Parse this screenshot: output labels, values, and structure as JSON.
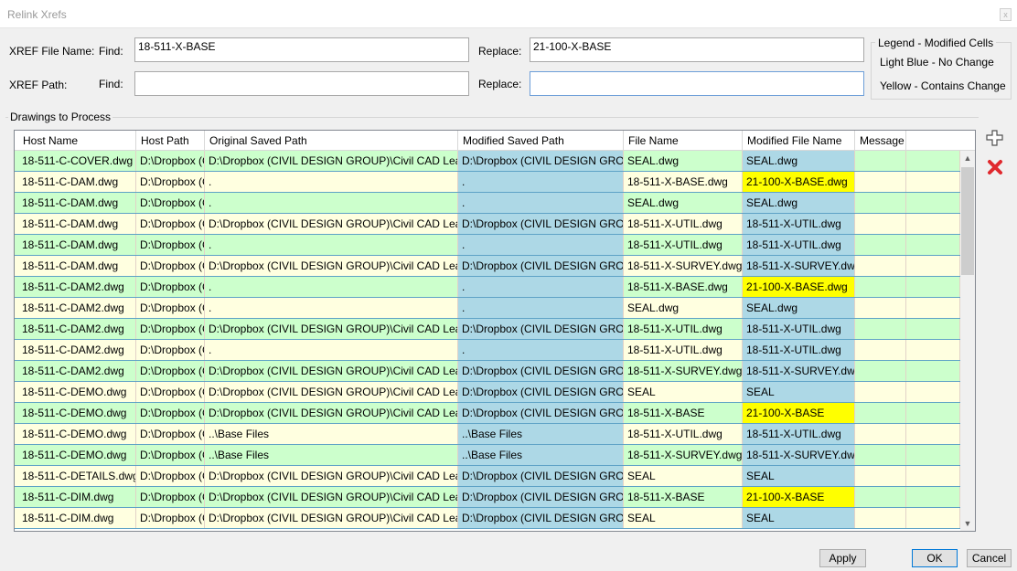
{
  "window": {
    "title": "Relink Xrefs",
    "close_glyph": "x"
  },
  "xref_file_name": {
    "label": "XREF File Name:",
    "find_label": "Find:",
    "find_value": "18-511-X-BASE",
    "replace_label": "Replace:",
    "replace_value": "21-100-X-BASE"
  },
  "xref_path": {
    "label": "XREF Path:",
    "find_label": "Find:",
    "find_value": "",
    "replace_label": "Replace:",
    "replace_value": ""
  },
  "legend": {
    "title": "Legend - Modified Cells",
    "light_blue": "Light Blue - No Change",
    "yellow": "Yellow - Contains Change"
  },
  "drawings": {
    "group_title": "Drawings to Process",
    "columns": [
      "Host Name",
      "Host Path",
      "Original Saved Path",
      "Modified Saved Path",
      "File Name",
      "Modified File Name",
      "Message"
    ],
    "rows": [
      {
        "host": "18-511-C-COVER.dwg",
        "path": "D:\\Dropbox (CIVIL DESIGN GROUP)\\Civil CAD Learn",
        "orig": "D:\\Dropbox (CIVIL DESIGN GROUP)\\Civil CAD Learn",
        "mod": "D:\\Dropbox (CIVIL DESIGN GROUP)\\Civil CAD Learn",
        "file": "SEAL.dwg",
        "mfile": "SEAL.dwg",
        "msg": "",
        "rowc": "g",
        "modc": "blue",
        "mfilec": "blue"
      },
      {
        "host": "18-511-C-DAM.dwg",
        "path": "D:\\Dropbox (CIVIL DESIGN GROUP)\\Civil CAD Learn",
        "orig": ".",
        "mod": ".",
        "file": "18-511-X-BASE.dwg",
        "mfile": "21-100-X-BASE.dwg",
        "msg": "",
        "rowc": "y",
        "modc": "blue",
        "mfilec": "yel"
      },
      {
        "host": "18-511-C-DAM.dwg",
        "path": "D:\\Dropbox (CIVIL DESIGN GROUP)\\Civil CAD Learn",
        "orig": ".",
        "mod": ".",
        "file": "SEAL.dwg",
        "mfile": "SEAL.dwg",
        "msg": "",
        "rowc": "g",
        "modc": "blue",
        "mfilec": "blue"
      },
      {
        "host": "18-511-C-DAM.dwg",
        "path": "D:\\Dropbox (CIVIL DESIGN GROUP)\\Civil CAD Learn",
        "orig": "D:\\Dropbox (CIVIL DESIGN GROUP)\\Civil CAD Learn",
        "mod": "D:\\Dropbox (CIVIL DESIGN GROUP)\\Civil CAD Learn",
        "file": "18-511-X-UTIL.dwg",
        "mfile": "18-511-X-UTIL.dwg",
        "msg": "",
        "rowc": "y",
        "modc": "blue",
        "mfilec": "blue"
      },
      {
        "host": "18-511-C-DAM.dwg",
        "path": "D:\\Dropbox (CIVIL DESIGN GROUP)\\Civil CAD Learn",
        "orig": ".",
        "mod": ".",
        "file": "18-511-X-UTIL.dwg",
        "mfile": "18-511-X-UTIL.dwg",
        "msg": "",
        "rowc": "g",
        "modc": "blue",
        "mfilec": "blue"
      },
      {
        "host": "18-511-C-DAM.dwg",
        "path": "D:\\Dropbox (CIVIL DESIGN GROUP)\\Civil CAD Learn",
        "orig": "D:\\Dropbox (CIVIL DESIGN GROUP)\\Civil CAD Learn",
        "mod": "D:\\Dropbox (CIVIL DESIGN GROUP)\\Civil CAD Learn",
        "file": "18-511-X-SURVEY.dwg",
        "mfile": "18-511-X-SURVEY.dwg",
        "msg": "",
        "rowc": "y",
        "modc": "blue",
        "mfilec": "blue"
      },
      {
        "host": "18-511-C-DAM2.dwg",
        "path": "D:\\Dropbox (CIVIL DESIGN GROUP)\\Civil CAD Learn",
        "orig": ".",
        "mod": ".",
        "file": "18-511-X-BASE.dwg",
        "mfile": "21-100-X-BASE.dwg",
        "msg": "",
        "rowc": "g",
        "modc": "blue",
        "mfilec": "yel"
      },
      {
        "host": "18-511-C-DAM2.dwg",
        "path": "D:\\Dropbox (CIVIL DESIGN GROUP)\\Civil CAD Learn",
        "orig": ".",
        "mod": ".",
        "file": "SEAL.dwg",
        "mfile": "SEAL.dwg",
        "msg": "",
        "rowc": "y",
        "modc": "blue",
        "mfilec": "blue"
      },
      {
        "host": "18-511-C-DAM2.dwg",
        "path": "D:\\Dropbox (CIVIL DESIGN GROUP)\\Civil CAD Learn",
        "orig": "D:\\Dropbox (CIVIL DESIGN GROUP)\\Civil CAD Learn",
        "mod": "D:\\Dropbox (CIVIL DESIGN GROUP)\\Civil CAD Learn",
        "file": "18-511-X-UTIL.dwg",
        "mfile": "18-511-X-UTIL.dwg",
        "msg": "",
        "rowc": "g",
        "modc": "blue",
        "mfilec": "blue"
      },
      {
        "host": "18-511-C-DAM2.dwg",
        "path": "D:\\Dropbox (CIVIL DESIGN GROUP)\\Civil CAD Learn",
        "orig": ".",
        "mod": ".",
        "file": "18-511-X-UTIL.dwg",
        "mfile": "18-511-X-UTIL.dwg",
        "msg": "",
        "rowc": "y",
        "modc": "blue",
        "mfilec": "blue"
      },
      {
        "host": "18-511-C-DAM2.dwg",
        "path": "D:\\Dropbox (CIVIL DESIGN GROUP)\\Civil CAD Learn",
        "orig": "D:\\Dropbox (CIVIL DESIGN GROUP)\\Civil CAD Learn",
        "mod": "D:\\Dropbox (CIVIL DESIGN GROUP)\\Civil CAD Learn",
        "file": "18-511-X-SURVEY.dwg",
        "mfile": "18-511-X-SURVEY.dwg",
        "msg": "",
        "rowc": "g",
        "modc": "blue",
        "mfilec": "blue"
      },
      {
        "host": "18-511-C-DEMO.dwg",
        "path": "D:\\Dropbox (CIVIL DESIGN GROUP)\\Civil CAD Learn",
        "orig": "D:\\Dropbox (CIVIL DESIGN GROUP)\\Civil CAD Learn",
        "mod": "D:\\Dropbox (CIVIL DESIGN GROUP)\\Civil CAD Learn",
        "file": "SEAL",
        "mfile": "SEAL",
        "msg": "",
        "rowc": "y",
        "modc": "blue",
        "mfilec": "blue"
      },
      {
        "host": "18-511-C-DEMO.dwg",
        "path": "D:\\Dropbox (CIVIL DESIGN GROUP)\\Civil CAD Learn",
        "orig": "D:\\Dropbox (CIVIL DESIGN GROUP)\\Civil CAD Learn",
        "mod": "D:\\Dropbox (CIVIL DESIGN GROUP)\\Civil CAD Learn",
        "file": "18-511-X-BASE",
        "mfile": "21-100-X-BASE",
        "msg": "",
        "rowc": "g",
        "modc": "blue",
        "mfilec": "yel"
      },
      {
        "host": "18-511-C-DEMO.dwg",
        "path": "D:\\Dropbox (CIVIL DESIGN GROUP)\\Civil CAD Learn",
        "orig": "..\\Base Files",
        "mod": "..\\Base Files",
        "file": "18-511-X-UTIL.dwg",
        "mfile": "18-511-X-UTIL.dwg",
        "msg": "",
        "rowc": "y",
        "modc": "blue",
        "mfilec": "blue"
      },
      {
        "host": "18-511-C-DEMO.dwg",
        "path": "D:\\Dropbox (CIVIL DESIGN GROUP)\\Civil CAD Learn",
        "orig": "..\\Base Files",
        "mod": "..\\Base Files",
        "file": "18-511-X-SURVEY.dwg",
        "mfile": "18-511-X-SURVEY.dwg",
        "msg": "",
        "rowc": "g",
        "modc": "blue",
        "mfilec": "blue"
      },
      {
        "host": "18-511-C-DETAILS.dwg",
        "path": "D:\\Dropbox (CIVIL DESIGN GROUP)\\Civil CAD Learn",
        "orig": "D:\\Dropbox (CIVIL DESIGN GROUP)\\Civil CAD Learn",
        "mod": "D:\\Dropbox (CIVIL DESIGN GROUP)\\Civil CAD Learn",
        "file": "SEAL",
        "mfile": "SEAL",
        "msg": "",
        "rowc": "y",
        "modc": "blue",
        "mfilec": "blue"
      },
      {
        "host": "18-511-C-DIM.dwg",
        "path": "D:\\Dropbox (CIVIL DESIGN GROUP)\\Civil CAD Learn",
        "orig": "D:\\Dropbox (CIVIL DESIGN GROUP)\\Civil CAD Learn",
        "mod": "D:\\Dropbox (CIVIL DESIGN GROUP)\\Civil CAD Learn",
        "file": "18-511-X-BASE",
        "mfile": "21-100-X-BASE",
        "msg": "",
        "rowc": "g",
        "modc": "blue",
        "mfilec": "yel"
      },
      {
        "host": "18-511-C-DIM.dwg",
        "path": "D:\\Dropbox (CIVIL DESIGN GROUP)\\Civil CAD Learn",
        "orig": "D:\\Dropbox (CIVIL DESIGN GROUP)\\Civil CAD Learn",
        "mod": "D:\\Dropbox (CIVIL DESIGN GROUP)\\Civil CAD Learn",
        "file": "SEAL",
        "mfile": "SEAL",
        "msg": "",
        "rowc": "y",
        "modc": "blue",
        "mfilec": "blue"
      }
    ]
  },
  "side_buttons": {
    "add_icon": "plus-icon",
    "delete_icon": "red-x-icon"
  },
  "buttons": {
    "apply": "Apply",
    "ok": "OK",
    "cancel": "Cancel"
  },
  "colors": {
    "green_row": "#ccffcc",
    "cream_row": "#ffffe0",
    "light_blue": "#add8e6",
    "yellow": "#ffff00"
  }
}
